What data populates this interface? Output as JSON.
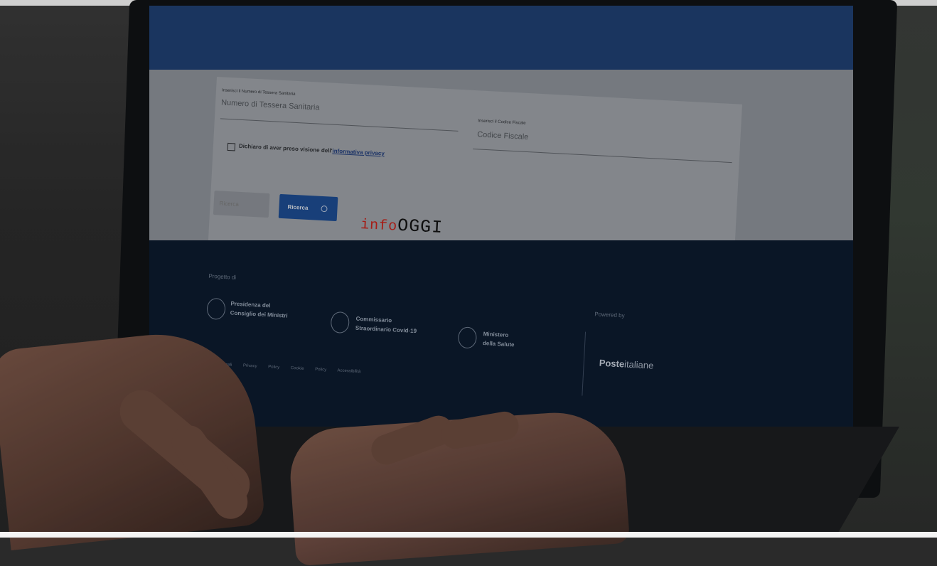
{
  "form": {
    "field1_label": "Inserisci il Numero di Tessera Sanitaria",
    "field1_placeholder": "Numero di Tessera Sanitaria",
    "field2_label": "Inserisci il Codice Fiscale",
    "field2_placeholder": "Codice Fiscale",
    "privacy_text": "Dichiaro di aver preso visione dell'",
    "privacy_link": "informativa privacy",
    "button_disabled": "Ricerca",
    "button_submit": "Ricerca"
  },
  "footer": {
    "progetto": "Progetto di",
    "inst1_line1": "Presidenza del",
    "inst1_line2": "Consiglio dei Ministri",
    "inst2_line1": "Commissario",
    "inst2_line2": "Straordinario Covid-19",
    "inst3_line1": "Ministero",
    "inst3_line2": "della Salute",
    "powered_by": "Powered by",
    "poste_bold": "Poste",
    "poste_rest": "italiane",
    "links": "Note Legali Privacy Policy Cookie Policy Accessibilità"
  },
  "watermark": {
    "part1": "info",
    "part2": "OGGI"
  }
}
